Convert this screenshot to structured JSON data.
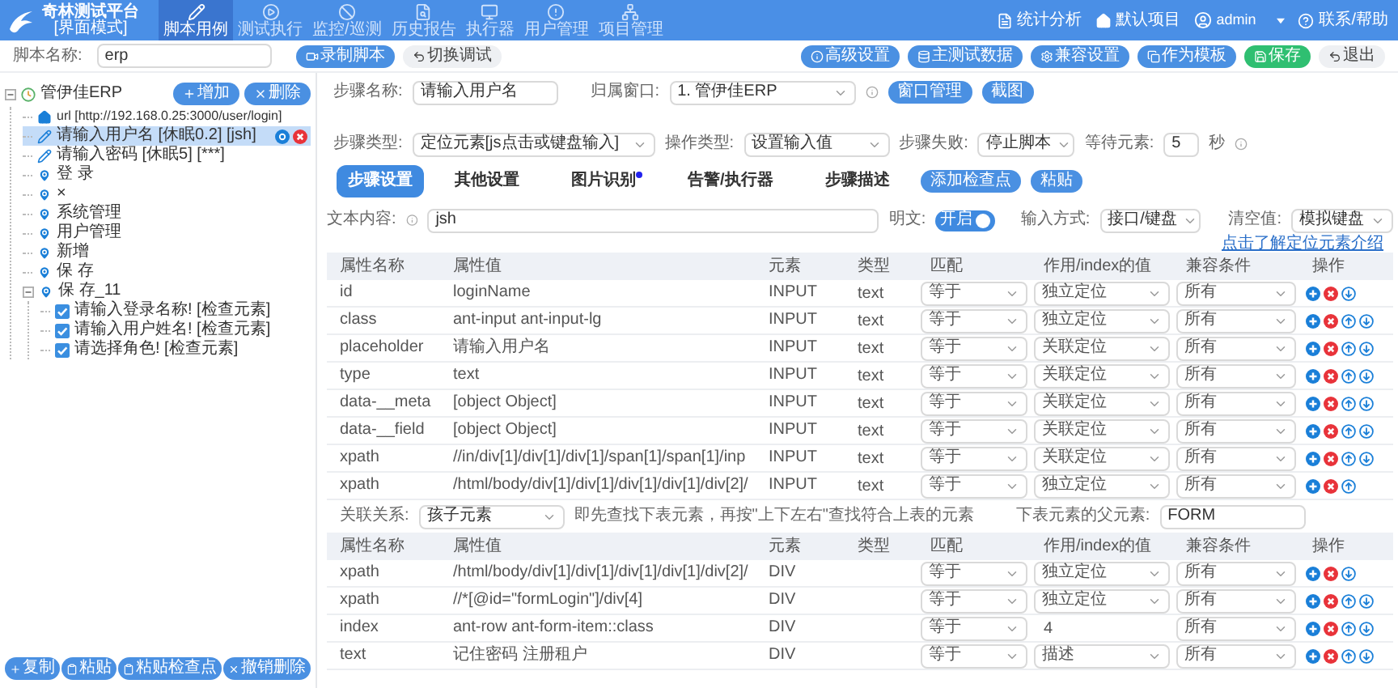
{
  "header": {
    "logo_title": "奇林测试平台",
    "logo_subtitle": "[界面模式]",
    "nav": [
      {
        "label": "脚本用例",
        "selected": true
      },
      {
        "label": "测试执行",
        "selected": false
      },
      {
        "label": "监控/巡测",
        "selected": false
      },
      {
        "label": "历史报告",
        "selected": false
      },
      {
        "label": "执行器",
        "selected": false
      },
      {
        "label": "用户管理",
        "selected": false
      },
      {
        "label": "项目管理",
        "selected": false
      }
    ],
    "stats": "统计分析",
    "project": "默认项目",
    "user": "admin",
    "help": "联系/帮助"
  },
  "toolbar": {
    "script_label": "脚本名称:",
    "script_value": "erp",
    "left_buttons": [
      {
        "label": "录制脚本",
        "kind": "primary"
      },
      {
        "label": "切换调试",
        "kind": "plain"
      }
    ],
    "right_buttons": [
      {
        "label": "高级设置",
        "kind": "primary"
      },
      {
        "label": "主测试数据",
        "kind": "primary"
      },
      {
        "label": "兼容设置",
        "kind": "primary"
      },
      {
        "label": "作为模板",
        "kind": "primary"
      },
      {
        "label": "保存",
        "kind": "success"
      },
      {
        "label": "退出",
        "kind": "plain"
      }
    ]
  },
  "sidebar": {
    "add": "增加",
    "delete": "删除",
    "tree": {
      "label": "管伊佳ERP",
      "expanded": true,
      "selected": false,
      "children": [
        {
          "kind": "url",
          "label": "url [http://192.168.0.25:3000/user/login]",
          "selected": false
        },
        {
          "kind": "input",
          "label": "请输入用户名 [休眠0.2] [jsh]",
          "selected": true
        },
        {
          "kind": "input",
          "label": "请输入密码 [休眠5] [***]",
          "selected": false
        },
        {
          "kind": "step",
          "label": "登 录",
          "selected": false
        },
        {
          "kind": "step",
          "label": "×",
          "selected": false
        },
        {
          "kind": "step",
          "label": "系统管理",
          "selected": false
        },
        {
          "kind": "step",
          "label": "用户管理",
          "selected": false
        },
        {
          "kind": "step",
          "label": "新增",
          "selected": false
        },
        {
          "kind": "step",
          "label": "保 存",
          "selected": false
        },
        {
          "kind": "step",
          "label": "保 存_11",
          "selected": false,
          "expanded": true,
          "children": [
            {
              "kind": "check",
              "label": "请输入登录名称! [检查元素]",
              "selected": false,
              "checked": true
            },
            {
              "kind": "check",
              "label": "请输入用户姓名! [检查元素]",
              "selected": false,
              "checked": true
            },
            {
              "kind": "check",
              "label": "请选择角色! [检查元素]",
              "selected": false,
              "checked": true
            }
          ]
        }
      ]
    },
    "bottom_buttons": [
      "复制",
      "粘贴",
      "粘贴检查点",
      "撤销删除"
    ]
  },
  "step_form": {
    "name_label": "步骤名称:",
    "name_value": "请输入用户名",
    "window_label": "归属窗口:",
    "window_value": "1. 管伊佳ERP",
    "window_buttons": [
      "窗口管理",
      "截图"
    ],
    "type_label": "步骤类型:",
    "type_value": "定位元素[js点击或键盘输入]",
    "op_label": "操作类型:",
    "op_value": "设置输入值",
    "fail_label": "步骤失败:",
    "fail_value": "停止脚本",
    "wait_label": "等待元素:",
    "wait_value": "5",
    "wait_unit": "秒"
  },
  "tabs": [
    {
      "label": "步骤设置",
      "selected": true,
      "dot": false
    },
    {
      "label": "其他设置",
      "selected": false,
      "dot": false
    },
    {
      "label": "图片识别",
      "selected": false,
      "dot": true
    },
    {
      "label": "告警/执行器",
      "selected": false,
      "dot": false
    },
    {
      "label": "步骤描述",
      "selected": false,
      "dot": false
    }
  ],
  "tab_buttons": [
    "添加检查点",
    "粘贴"
  ],
  "text_row": {
    "label": "文本内容:",
    "value": "jsh",
    "plain_label": "明文:",
    "plain_on": true,
    "plain_text": "开启",
    "input_label": "输入方式:",
    "input_value": "接口/键盘",
    "clear_label": "清空值:",
    "clear_value": "模拟键盘"
  },
  "help_link": "点击了解定位元素介绍",
  "table1": {
    "columns": [
      "属性名称",
      "属性值",
      "元素",
      "类型",
      "匹配",
      "作用/index的值",
      "兼容条件",
      "操作"
    ],
    "rows": [
      {
        "name": "id",
        "value": "loginName",
        "element": "INPUT",
        "type": "text",
        "match": "等于",
        "role": "独立定位",
        "role_editable": true,
        "compat": "所有",
        "can_up": false,
        "can_down": true
      },
      {
        "name": "class",
        "value": "ant-input ant-input-lg",
        "element": "INPUT",
        "type": "text",
        "match": "等于",
        "role": "独立定位",
        "role_editable": true,
        "compat": "所有",
        "can_up": true,
        "can_down": true
      },
      {
        "name": "placeholder",
        "value": "请输入用户名",
        "element": "INPUT",
        "type": "text",
        "match": "等于",
        "role": "关联定位",
        "role_editable": true,
        "compat": "所有",
        "can_up": true,
        "can_down": true
      },
      {
        "name": "type",
        "value": "text",
        "element": "INPUT",
        "type": "text",
        "match": "等于",
        "role": "关联定位",
        "role_editable": true,
        "compat": "所有",
        "can_up": true,
        "can_down": true
      },
      {
        "name": "data-__meta",
        "value": "[object Object]",
        "element": "INPUT",
        "type": "text",
        "match": "等于",
        "role": "关联定位",
        "role_editable": true,
        "compat": "所有",
        "can_up": true,
        "can_down": true
      },
      {
        "name": "data-__field",
        "value": "[object Object]",
        "element": "INPUT",
        "type": "text",
        "match": "等于",
        "role": "关联定位",
        "role_editable": true,
        "compat": "所有",
        "can_up": true,
        "can_down": true
      },
      {
        "name": "xpath",
        "value": "//in/div[1]/div[1]/div[1]/span[1]/span[1]/inp",
        "element": "INPUT",
        "type": "text",
        "match": "等于",
        "role": "关联定位",
        "role_editable": true,
        "compat": "所有",
        "can_up": true,
        "can_down": true
      },
      {
        "name": "xpath",
        "value": "/html/body/div[1]/div[1]/div[1]/div[1]/div[2]/",
        "element": "INPUT",
        "type": "text",
        "match": "等于",
        "role": "独立定位",
        "role_editable": true,
        "compat": "所有",
        "can_up": true,
        "can_down": false
      }
    ]
  },
  "relation": {
    "label": "关联关系:",
    "value": "孩子元素",
    "hint": "即先查找下表元素，再按\"上下左右\"查找符合上表的元素",
    "parent_label": "下表元素的父元素:",
    "parent_value": "FORM"
  },
  "table2": {
    "columns": [
      "属性名称",
      "属性值",
      "元素",
      "类型",
      "匹配",
      "作用/index的值",
      "兼容条件",
      "操作"
    ],
    "rows": [
      {
        "name": "xpath",
        "value": "/html/body/div[1]/div[1]/div[1]/div[1]/div[2]/",
        "element": "DIV",
        "match": "等于",
        "role": "独立定位",
        "role_editable": true,
        "compat": "所有",
        "can_up": false,
        "can_down": true
      },
      {
        "name": "xpath",
        "value": "//*[@id=\"formLogin\"]/div[4]",
        "element": "DIV",
        "match": "等于",
        "role": "独立定位",
        "role_editable": true,
        "compat": "所有",
        "can_up": true,
        "can_down": true
      },
      {
        "name": "index",
        "value": "ant-row ant-form-item::class",
        "element": "DIV",
        "match": "等于",
        "role": "4",
        "role_editable": false,
        "compat": "所有",
        "can_up": true,
        "can_down": true
      },
      {
        "name": "text",
        "value": "记住密码 注册租户",
        "element": "DIV",
        "match": "等于",
        "role": "描述",
        "role_editable": true,
        "compat": "所有",
        "can_up": true,
        "can_down": true
      }
    ]
  }
}
